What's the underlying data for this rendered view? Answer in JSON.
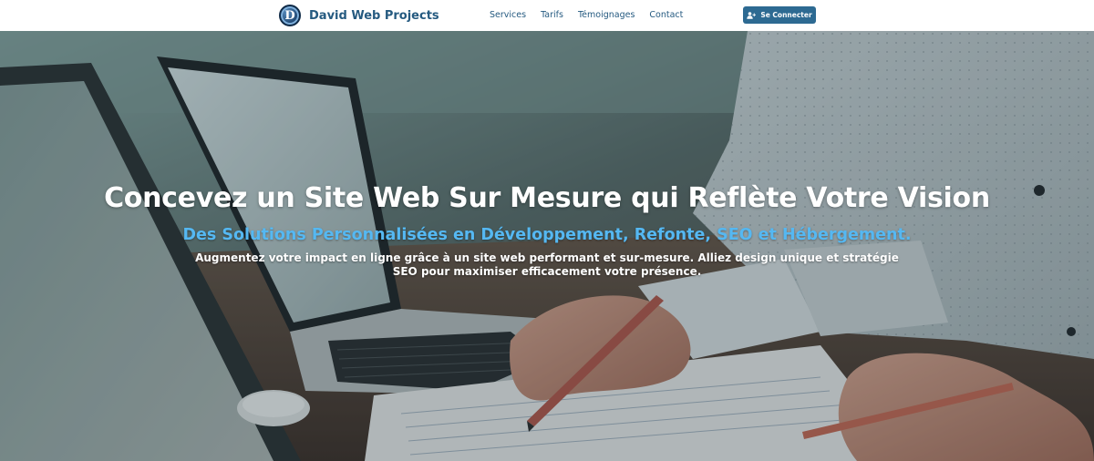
{
  "header": {
    "logo_letter": "D",
    "brand_name": "David Web Projects",
    "nav": [
      {
        "label": "Services"
      },
      {
        "label": "Tarifs"
      },
      {
        "label": "Témoignages"
      },
      {
        "label": "Contact"
      }
    ],
    "login_label": "Se Connecter",
    "login_icon": "user-plus-icon"
  },
  "hero": {
    "title": "Concevez un Site Web Sur Mesure qui Reflète Votre Vision",
    "subtitle": "Des Solutions Personnalisées en Développement, Refonte, SEO et Hébergement.",
    "text": "Augmentez votre impact en ligne grâce à un site web performant et sur-mesure. Alliez design unique et stratégie SEO pour maximiser efficacement votre présence.",
    "background": "photo-desk-laptops-pencil"
  },
  "colors": {
    "brand": "#255a80",
    "button": "#2d6a92",
    "subtitle": "#55b8f2"
  }
}
